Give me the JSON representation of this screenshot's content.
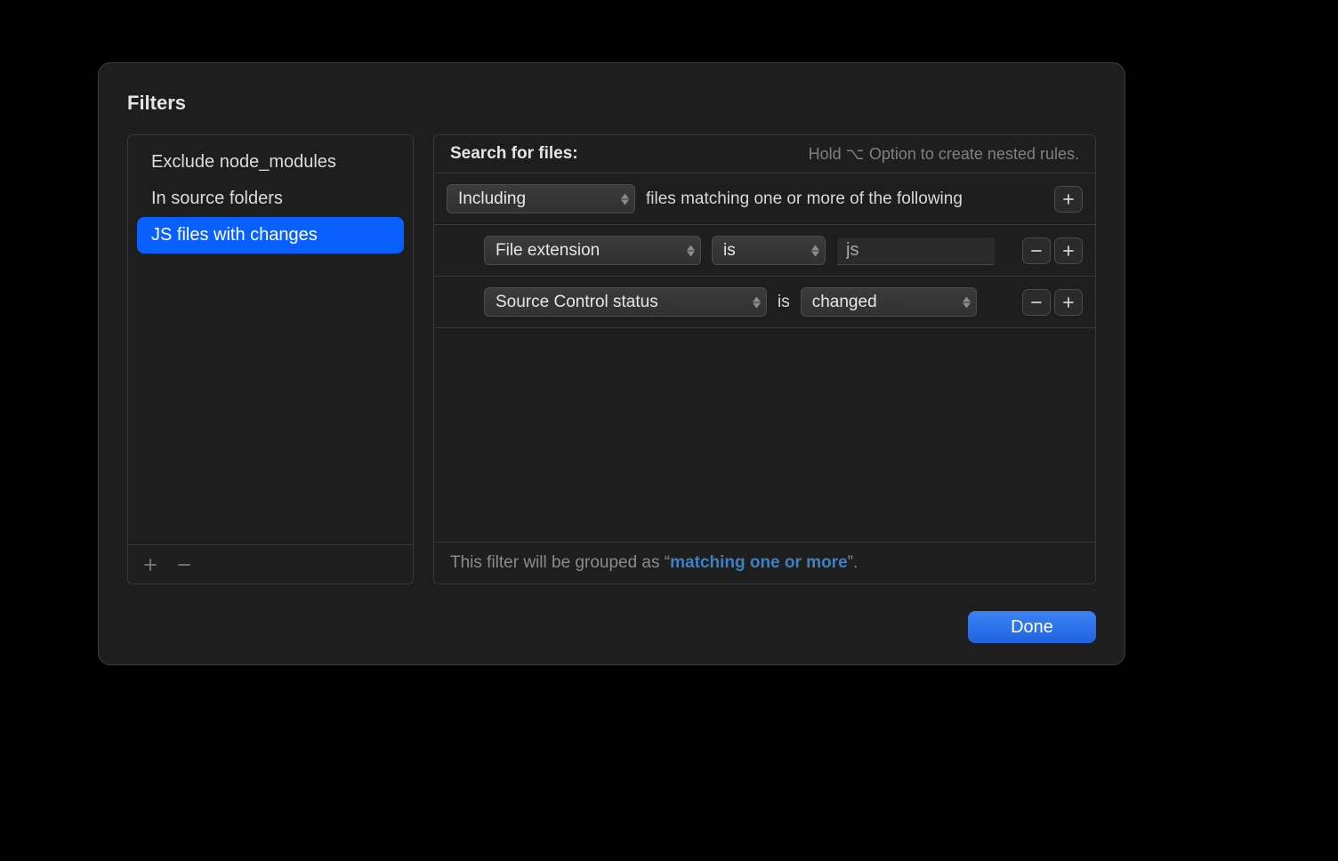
{
  "title": "Filters",
  "sidebar": {
    "items": [
      {
        "label": "Exclude node_modules",
        "selected": false
      },
      {
        "label": "In source folders",
        "selected": false
      },
      {
        "label": "JS files with changes",
        "selected": true
      }
    ]
  },
  "rules": {
    "caption": "Search for files:",
    "hint_prefix": "Hold ",
    "hint_key": "⌥",
    "hint_rest": " Option to create nested rules.",
    "top_condition": {
      "mode": "Including",
      "text": "files matching one or more of the following"
    },
    "rows": [
      {
        "field": "File extension",
        "op": "is",
        "value": "js",
        "input_kind": "text"
      },
      {
        "field": "Source Control status",
        "op_text": "is",
        "value": "changed",
        "input_kind": "popup"
      }
    ],
    "footer_prefix": "This filter will be grouped as “",
    "footer_link": "matching one or more",
    "footer_suffix": "”."
  },
  "done_label": "Done"
}
